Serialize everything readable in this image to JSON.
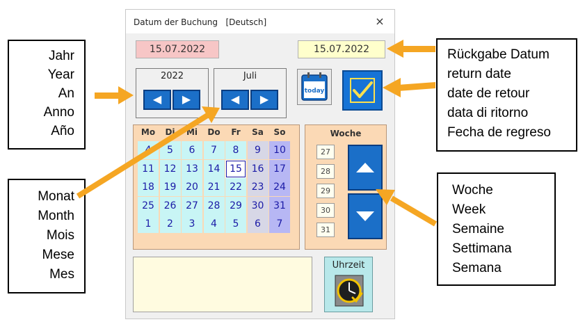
{
  "dialog": {
    "title": "Datum der Buchung   [Deutsch]",
    "close": "×",
    "date_left": "15.07.2022",
    "date_right": "15.07.2022",
    "year_group": {
      "label": "2022",
      "prev": "◀",
      "next": "▶"
    },
    "month_group": {
      "label": "Juli",
      "prev": "◀",
      "next": "▶"
    },
    "today_icon_text": "today",
    "calendar": {
      "days_of_week": [
        "Mo",
        "Di",
        "Mi",
        "Do",
        "Fr",
        "Sa",
        "So"
      ],
      "weeks": [
        [
          "4",
          "5",
          "6",
          "7",
          "8",
          "9",
          "10"
        ],
        [
          "11",
          "12",
          "13",
          "14",
          "15",
          "16",
          "17"
        ],
        [
          "18",
          "19",
          "20",
          "21",
          "22",
          "23",
          "24"
        ],
        [
          "25",
          "26",
          "27",
          "28",
          "29",
          "30",
          "31"
        ],
        [
          "1",
          "2",
          "3",
          "4",
          "5",
          "6",
          "7"
        ]
      ],
      "selected_day": "15"
    },
    "week_panel": {
      "label": "Woche",
      "numbers": [
        "27",
        "28",
        "29",
        "30",
        "31"
      ]
    },
    "clock_button_label": "Uhrzeit"
  },
  "callouts": {
    "year": [
      "Jahr",
      "Year",
      "An",
      "Anno",
      "Año"
    ],
    "return_date": [
      "Rückgabe Datum",
      "return date",
      "date de retour",
      "data di ritorno",
      "Fecha de regreso"
    ],
    "month": [
      "Monat",
      "Month",
      "Mois",
      "Mese",
      "Mes"
    ],
    "week": [
      "Woche",
      "Week",
      "Semaine",
      "Settimana",
      "Semana"
    ]
  },
  "colors": {
    "arrow": "#f5a623",
    "button_blue": "#1b6fc8",
    "calendar_bg": "#fbd9b5"
  }
}
